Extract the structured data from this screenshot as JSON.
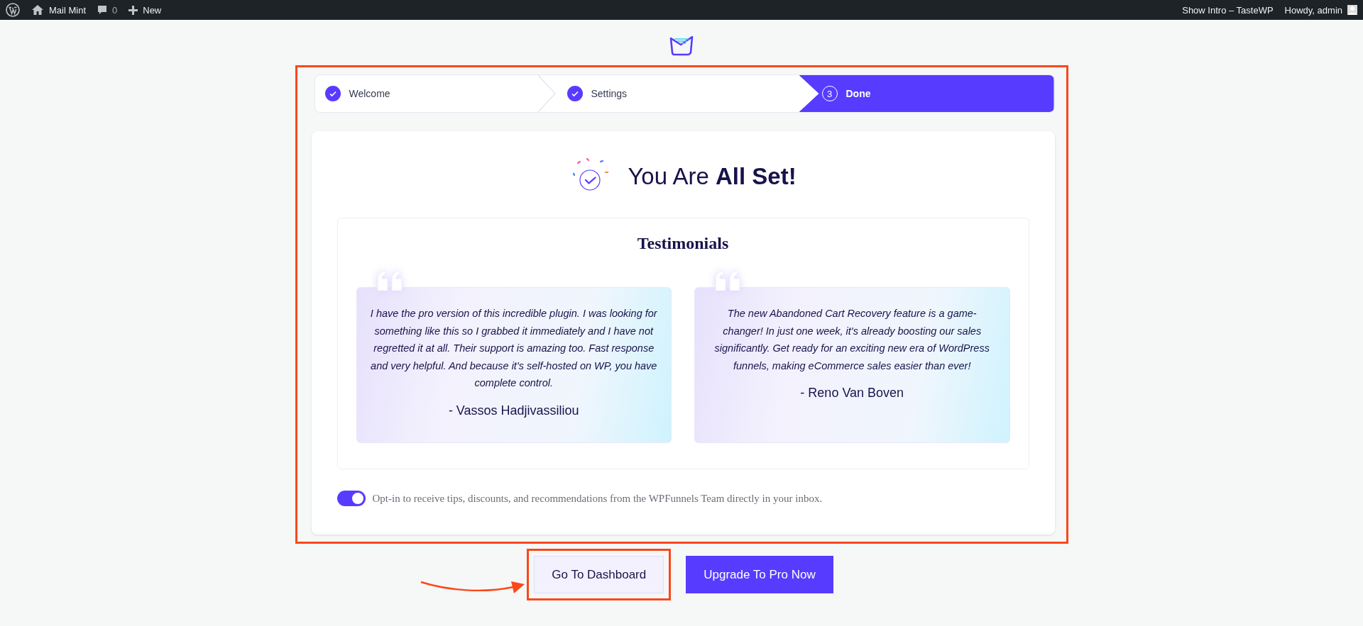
{
  "admin_bar": {
    "left": [
      {
        "kind": "wordpress"
      },
      {
        "kind": "home",
        "label": "Mail Mint"
      },
      {
        "kind": "comments",
        "label": "0"
      },
      {
        "kind": "new",
        "label": "New"
      }
    ],
    "right": [
      {
        "kind": "link",
        "label": "Show Intro – TasteWP"
      },
      {
        "kind": "account",
        "label": "Howdy, admin"
      }
    ]
  },
  "wizard": {
    "highlighted": true,
    "steps": [
      {
        "label": "Welcome",
        "completed": true,
        "selected": false
      },
      {
        "label": "Settings",
        "completed": true,
        "selected": false
      },
      {
        "label": "Done",
        "number": "3",
        "completed": false,
        "selected": true
      }
    ],
    "heading": "You Are **All Set!**",
    "testimonials": {
      "title": "Testimonials",
      "items": [
        {
          "quote": "I have the pro version of this incredible plugin. I was looking for something like this so I grabbed it immediately and I have not regretted it at all. Their support is amazing too. Fast response and very helpful. And because it's self-hosted on WP, you have complete control.",
          "author": "- Vassos Hadjivassiliou"
        },
        {
          "quote": "The new Abandoned Cart Recovery feature is a game-changer! In just one week, it's already boosting our sales significantly. Get ready for an exciting new era of WordPress funnels, making eCommerce sales easier than ever!",
          "author": "- Reno Van Boven"
        }
      ]
    },
    "opt_in": {
      "on": true,
      "label": "Opt-in to receive tips, discounts, and recommendations from the WPFunnels Team directly in your inbox."
    }
  },
  "buttons": [
    {
      "label": "Go To Dashboard",
      "kind": "secondary",
      "highlighted": true,
      "pointer_arrow": true
    },
    {
      "label": "Upgrade To Pro Now",
      "kind": "primary",
      "highlighted": false,
      "pointer_arrow": false
    }
  ]
}
